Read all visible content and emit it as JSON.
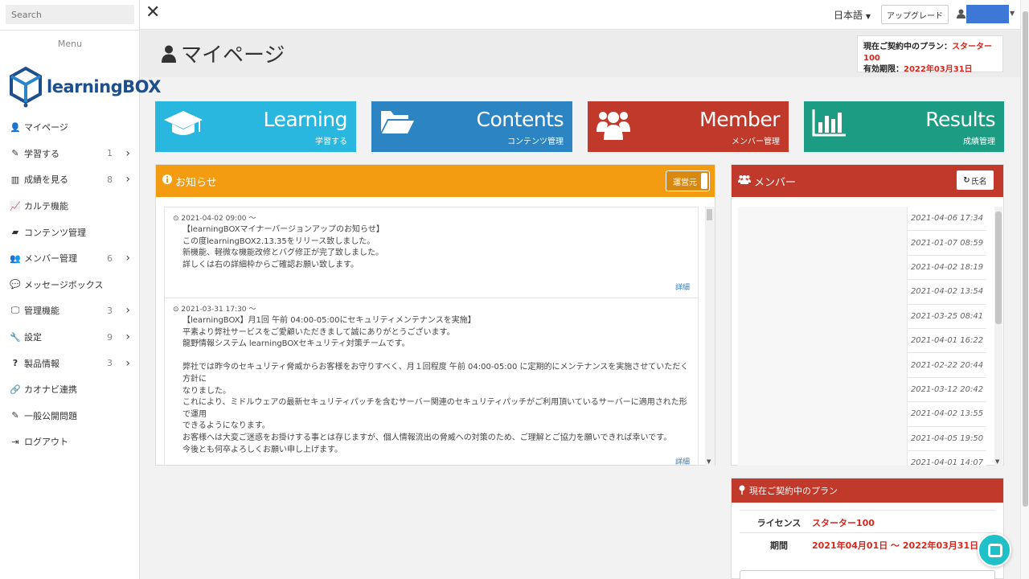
{
  "sidebar": {
    "search_placeholder": "Search",
    "menu_label": "Menu",
    "logo_text": "learningBOX",
    "items": [
      {
        "label": "マイページ",
        "icon": "user-icon",
        "count": "",
        "chevron": false
      },
      {
        "label": "学習する",
        "icon": "pencil-icon",
        "count": "1",
        "chevron": true
      },
      {
        "label": "成績を見る",
        "icon": "bar-chart-icon",
        "count": "8",
        "chevron": true
      },
      {
        "label": "カルテ機能",
        "icon": "line-chart-icon",
        "count": "",
        "chevron": false
      },
      {
        "label": "コンテンツ管理",
        "icon": "folder-icon",
        "count": "",
        "chevron": false
      },
      {
        "label": "メンバー管理",
        "icon": "users-icon",
        "count": "6",
        "chevron": true
      },
      {
        "label": "メッセージボックス",
        "icon": "comments-icon",
        "count": "",
        "chevron": false
      },
      {
        "label": "管理機能",
        "icon": "monitor-icon",
        "count": "3",
        "chevron": true
      },
      {
        "label": "設定",
        "icon": "wrench-icon",
        "count": "9",
        "chevron": true
      },
      {
        "label": "製品情報",
        "icon": "question-icon",
        "count": "3",
        "chevron": true
      },
      {
        "label": "カオナビ連携",
        "icon": "link-icon",
        "count": "",
        "chevron": false
      },
      {
        "label": "一般公開問題",
        "icon": "pencil-icon",
        "count": "",
        "chevron": false
      },
      {
        "label": "ログアウト",
        "icon": "sign-out-icon",
        "count": "",
        "chevron": false
      }
    ]
  },
  "topbar": {
    "language": "日本語",
    "upgrade_label": "アップグレード"
  },
  "header": {
    "page_title": "マイページ",
    "plan_label": "現在ご契約中のプラン：",
    "plan_value": "スターター100",
    "expiry_label": "有効期限：",
    "expiry_value": "2022年03月31日"
  },
  "tiles": [
    {
      "title": "Learning",
      "sub": "学習する",
      "color": "#29b6df",
      "icon": "graduation-cap-icon"
    },
    {
      "title": "Contents",
      "sub": "コンテンツ管理",
      "color": "#2c84c3",
      "icon": "folder-open-icon"
    },
    {
      "title": "Member",
      "sub": "メンバー管理",
      "color": "#c0392b",
      "icon": "users-icon"
    },
    {
      "title": "Results",
      "sub": "成績管理",
      "color": "#1d9c84",
      "icon": "bar-chart-icon"
    }
  ],
  "news": {
    "title": "お知らせ",
    "toggle_label": "運営元",
    "items": [
      {
        "date": "2021-04-02 09:00 ～",
        "body": "【learningBOXマイナーバージョンアップのお知らせ】\nこの度learningBOX2.13.35をリリース致しました。\n新機能、軽微な機能改修とバグ修正が完了致しました。\n詳しくは右の詳細枠からご確認お願い致します。",
        "detail": "詳細"
      },
      {
        "date": "2021-03-31 17:30 ～",
        "body": "【learningBOX】月1回 午前 04:00-05:00にセキュリティメンテナンスを実施】\n平素より弊社サービスをご愛顧いただきまして誠にありがとうございます。\n龍野情報システム learningBOXセキュリティ対策チームです。\n\n弊社では昨今のセキュリティ脅威からお客様をお守りすべく、月１回程度 午前 04:00-05:00 に定期的にメンテナンスを実施させていただく方針に\nなりました。\nこれにより、ミドルウェアの最新セキュリティパッチを含むサーバー関連のセキュリティパッチがご利用頂いているサーバーに適用された形で運用\nできるようになります。\nお客様へは大変ご迷惑をお掛けする事とは存じますが、個人情報流出の脅威への対策のため、ご理解とご協力を願いできれば幸いです。\n今後とも何卒よろしくお願い申し上げます。",
        "detail": "詳細"
      }
    ]
  },
  "members": {
    "title": "メンバー",
    "sort_label": "氏名",
    "dates": [
      "2021-04-06 17:34",
      "2021-01-07 08:59",
      "2021-04-02 18:19",
      "2021-04-02 13:54",
      "2021-03-25 08:41",
      "2021-04-01 16:22",
      "2021-02-22 20:44",
      "2021-03-12 20:42",
      "2021-04-02 13:55",
      "2021-04-05 19:50",
      "2021-04-01 14:07"
    ]
  },
  "contract": {
    "title": "現在ご契約中のプラン",
    "license_label": "ライセンス",
    "license_value": "スターター100",
    "period_label": "期間",
    "period_value": "2021年04月01日 ～ 2022年03月31日"
  }
}
